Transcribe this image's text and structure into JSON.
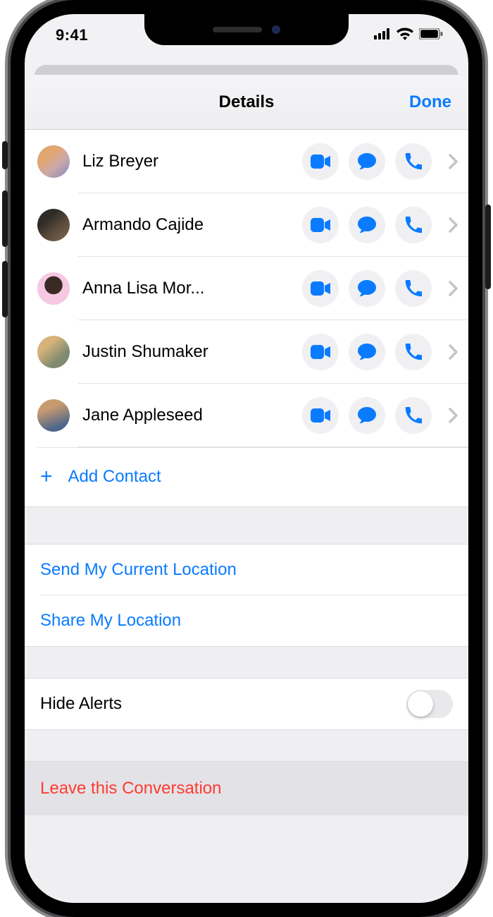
{
  "status": {
    "time": "9:41"
  },
  "nav": {
    "title": "Details",
    "done": "Done"
  },
  "contacts": [
    {
      "name": "Liz Breyer",
      "avatar_bg": "linear-gradient(140deg,#e1a56f 35%,#caa 60%,#88b 100%)"
    },
    {
      "name": "Armando Cajide",
      "avatar_bg": "linear-gradient(140deg,#2e2b28 30%,#5a4a3a 60%,#7c6a52 100%)"
    },
    {
      "name": "Anna Lisa Mor...",
      "avatar_bg": "radial-gradient(circle at 50% 40%, #3b2a24 0 35%, #f6c8e1 36% 100%)"
    },
    {
      "name": "Justin Shumaker",
      "avatar_bg": "linear-gradient(140deg,#d7b37a 30%,#7f8a70 70%)"
    },
    {
      "name": "Jane Appleseed",
      "avatar_bg": "linear-gradient(160deg,#c79a6f 30%,#4d668a 80%)"
    }
  ],
  "add_contact": "Add Contact",
  "location": {
    "send": "Send My Current Location",
    "share": "Share My Location"
  },
  "hide_alerts": {
    "label": "Hide Alerts",
    "value": false
  },
  "leave": "Leave this Conversation",
  "icons": {
    "video": "video-icon",
    "message": "message-icon",
    "phone": "phone-icon",
    "chevron": "chevron-right-icon",
    "plus": "plus-icon",
    "signal": "cellular-signal-icon",
    "wifi": "wifi-icon",
    "battery": "battery-icon"
  },
  "colors": {
    "accent": "#0a7bff",
    "danger": "#ff3b30"
  }
}
